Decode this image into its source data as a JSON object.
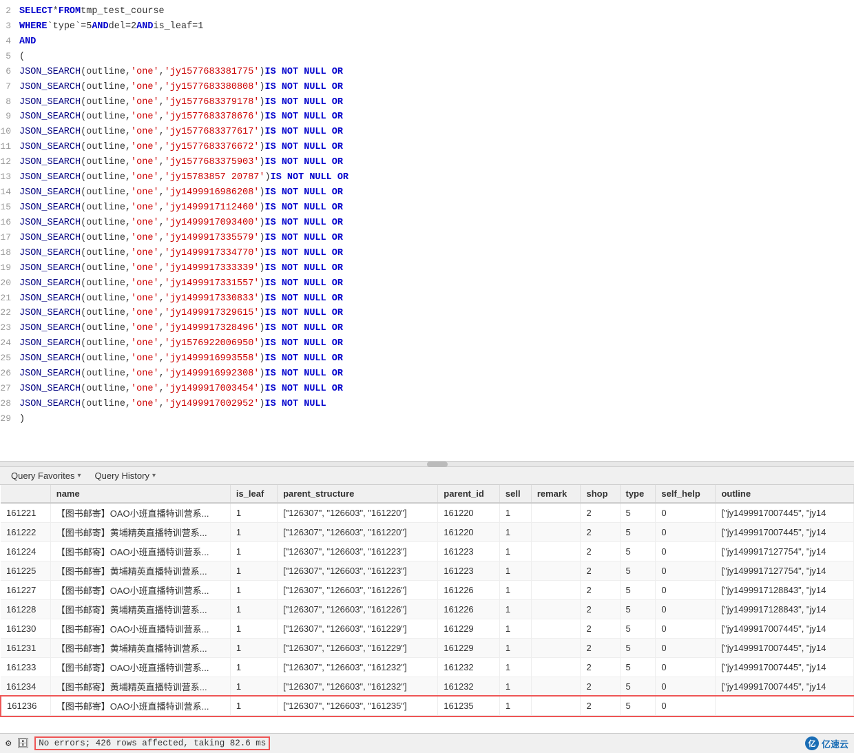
{
  "editor": {
    "lines": [
      {
        "num": 2,
        "tokens": [
          {
            "t": "kw",
            "v": "SELECT"
          },
          {
            "t": "plain",
            "v": " * "
          },
          {
            "t": "kw",
            "v": "FROM"
          },
          {
            "t": "plain",
            "v": " tmp_test_course"
          }
        ]
      },
      {
        "num": 3,
        "tokens": [
          {
            "t": "kw",
            "v": "WHERE"
          },
          {
            "t": "plain",
            "v": " "
          },
          {
            "t": "plain",
            "v": "`type`"
          },
          {
            "t": "plain",
            "v": "=5 "
          },
          {
            "t": "kw",
            "v": "AND"
          },
          {
            "t": "plain",
            "v": " del=2 "
          },
          {
            "t": "kw",
            "v": "AND"
          },
          {
            "t": "plain",
            "v": " is_leaf=1"
          }
        ]
      },
      {
        "num": 4,
        "tokens": [
          {
            "t": "kw",
            "v": "AND"
          }
        ]
      },
      {
        "num": 5,
        "tokens": [
          {
            "t": "plain",
            "v": "("
          }
        ]
      },
      {
        "num": 6,
        "tokens": [
          {
            "t": "fn",
            "v": "JSON_SEARCH"
          },
          {
            "t": "plain",
            "v": "(outline, "
          },
          {
            "t": "str",
            "v": "'one'"
          },
          {
            "t": "plain",
            "v": ", "
          },
          {
            "t": "str",
            "v": "'jy1577683381775'"
          },
          {
            "t": "plain",
            "v": ")"
          },
          {
            "t": "op",
            "v": " IS NOT NULL OR"
          }
        ]
      },
      {
        "num": 7,
        "tokens": [
          {
            "t": "fn",
            "v": "JSON_SEARCH"
          },
          {
            "t": "plain",
            "v": "(outline, "
          },
          {
            "t": "str",
            "v": "'one'"
          },
          {
            "t": "plain",
            "v": ", "
          },
          {
            "t": "str",
            "v": "'jy1577683380808'"
          },
          {
            "t": "plain",
            "v": ")"
          },
          {
            "t": "op",
            "v": " IS NOT NULL OR"
          }
        ]
      },
      {
        "num": 8,
        "tokens": [
          {
            "t": "fn",
            "v": "JSON_SEARCH"
          },
          {
            "t": "plain",
            "v": "(outline, "
          },
          {
            "t": "str",
            "v": "'one'"
          },
          {
            "t": "plain",
            "v": ", "
          },
          {
            "t": "str",
            "v": "'jy1577683379178'"
          },
          {
            "t": "plain",
            "v": ")"
          },
          {
            "t": "op",
            "v": " IS NOT NULL OR"
          }
        ]
      },
      {
        "num": 9,
        "tokens": [
          {
            "t": "fn",
            "v": "JSON_SEARCH"
          },
          {
            "t": "plain",
            "v": "(outline, "
          },
          {
            "t": "str",
            "v": "'one'"
          },
          {
            "t": "plain",
            "v": ", "
          },
          {
            "t": "str",
            "v": "'jy1577683378676'"
          },
          {
            "t": "plain",
            "v": ")"
          },
          {
            "t": "op",
            "v": " IS NOT NULL OR"
          }
        ]
      },
      {
        "num": 10,
        "tokens": [
          {
            "t": "fn",
            "v": "JSON_SEARCH"
          },
          {
            "t": "plain",
            "v": "(outline, "
          },
          {
            "t": "str",
            "v": "'one'"
          },
          {
            "t": "plain",
            "v": ", "
          },
          {
            "t": "str",
            "v": "'jy1577683377617'"
          },
          {
            "t": "plain",
            "v": ")"
          },
          {
            "t": "op",
            "v": " IS NOT NULL OR"
          }
        ]
      },
      {
        "num": 11,
        "tokens": [
          {
            "t": "fn",
            "v": "JSON_SEARCH"
          },
          {
            "t": "plain",
            "v": "(outline, "
          },
          {
            "t": "str",
            "v": "'one'"
          },
          {
            "t": "plain",
            "v": ", "
          },
          {
            "t": "str",
            "v": "'jy1577683376672'"
          },
          {
            "t": "plain",
            "v": ")"
          },
          {
            "t": "op",
            "v": " IS NOT NULL OR"
          }
        ]
      },
      {
        "num": 12,
        "tokens": [
          {
            "t": "fn",
            "v": "JSON_SEARCH"
          },
          {
            "t": "plain",
            "v": "(outline, "
          },
          {
            "t": "str",
            "v": "'one'"
          },
          {
            "t": "plain",
            "v": ", "
          },
          {
            "t": "str",
            "v": "'jy1577683375903'"
          },
          {
            "t": "plain",
            "v": ")"
          },
          {
            "t": "op",
            "v": " IS NOT NULL OR"
          }
        ]
      },
      {
        "num": 13,
        "tokens": [
          {
            "t": "fn",
            "v": "JSON_SEARCH"
          },
          {
            "t": "plain",
            "v": "(outline, "
          },
          {
            "t": "str",
            "v": "'one'"
          },
          {
            "t": "plain",
            "v": ", "
          },
          {
            "t": "str",
            "v": "'jy15783857 20787'"
          },
          {
            "t": "plain",
            "v": ")"
          },
          {
            "t": "op",
            "v": " IS NOT NULL OR"
          }
        ]
      },
      {
        "num": 14,
        "tokens": [
          {
            "t": "fn",
            "v": "JSON_SEARCH"
          },
          {
            "t": "plain",
            "v": "(outline, "
          },
          {
            "t": "str",
            "v": "'one'"
          },
          {
            "t": "plain",
            "v": ", "
          },
          {
            "t": "str",
            "v": "'jy1499916986208'"
          },
          {
            "t": "plain",
            "v": ")"
          },
          {
            "t": "op",
            "v": " IS NOT NULL OR"
          }
        ]
      },
      {
        "num": 15,
        "tokens": [
          {
            "t": "fn",
            "v": "JSON_SEARCH"
          },
          {
            "t": "plain",
            "v": "(outline, "
          },
          {
            "t": "str",
            "v": "'one'"
          },
          {
            "t": "plain",
            "v": ", "
          },
          {
            "t": "str",
            "v": "'jy1499917112460'"
          },
          {
            "t": "plain",
            "v": ")"
          },
          {
            "t": "op",
            "v": " IS NOT NULL OR"
          }
        ]
      },
      {
        "num": 16,
        "tokens": [
          {
            "t": "fn",
            "v": "JSON_SEARCH"
          },
          {
            "t": "plain",
            "v": "(outline, "
          },
          {
            "t": "str",
            "v": "'one'"
          },
          {
            "t": "plain",
            "v": ", "
          },
          {
            "t": "str",
            "v": "'jy1499917093400'"
          },
          {
            "t": "plain",
            "v": ")"
          },
          {
            "t": "op",
            "v": " IS NOT NULL OR"
          }
        ]
      },
      {
        "num": 17,
        "tokens": [
          {
            "t": "fn",
            "v": "JSON_SEARCH"
          },
          {
            "t": "plain",
            "v": "(outline, "
          },
          {
            "t": "str",
            "v": "'one'"
          },
          {
            "t": "plain",
            "v": ", "
          },
          {
            "t": "str",
            "v": "'jy1499917335579'"
          },
          {
            "t": "plain",
            "v": ")"
          },
          {
            "t": "op",
            "v": " IS NOT NULL OR"
          }
        ]
      },
      {
        "num": 18,
        "tokens": [
          {
            "t": "fn",
            "v": "JSON_SEARCH"
          },
          {
            "t": "plain",
            "v": "(outline, "
          },
          {
            "t": "str",
            "v": "'one'"
          },
          {
            "t": "plain",
            "v": ", "
          },
          {
            "t": "str",
            "v": "'jy1499917334770'"
          },
          {
            "t": "plain",
            "v": ")"
          },
          {
            "t": "op",
            "v": " IS NOT NULL OR"
          }
        ]
      },
      {
        "num": 19,
        "tokens": [
          {
            "t": "fn",
            "v": "JSON_SEARCH"
          },
          {
            "t": "plain",
            "v": "(outline, "
          },
          {
            "t": "str",
            "v": "'one'"
          },
          {
            "t": "plain",
            "v": ", "
          },
          {
            "t": "str",
            "v": "'jy1499917333339'"
          },
          {
            "t": "plain",
            "v": ")"
          },
          {
            "t": "op",
            "v": " IS NOT NULL OR"
          }
        ]
      },
      {
        "num": 20,
        "tokens": [
          {
            "t": "fn",
            "v": "JSON_SEARCH"
          },
          {
            "t": "plain",
            "v": "(outline, "
          },
          {
            "t": "str",
            "v": "'one'"
          },
          {
            "t": "plain",
            "v": ", "
          },
          {
            "t": "str",
            "v": "'jy1499917331557'"
          },
          {
            "t": "plain",
            "v": ")"
          },
          {
            "t": "op",
            "v": " IS NOT NULL OR"
          }
        ]
      },
      {
        "num": 21,
        "tokens": [
          {
            "t": "fn",
            "v": "JSON_SEARCH"
          },
          {
            "t": "plain",
            "v": "(outline, "
          },
          {
            "t": "str",
            "v": "'one'"
          },
          {
            "t": "plain",
            "v": ", "
          },
          {
            "t": "str",
            "v": "'jy1499917330833'"
          },
          {
            "t": "plain",
            "v": ")"
          },
          {
            "t": "op",
            "v": " IS NOT NULL OR"
          }
        ]
      },
      {
        "num": 22,
        "tokens": [
          {
            "t": "fn",
            "v": "JSON_SEARCH"
          },
          {
            "t": "plain",
            "v": "(outline, "
          },
          {
            "t": "str",
            "v": "'one'"
          },
          {
            "t": "plain",
            "v": ", "
          },
          {
            "t": "str",
            "v": "'jy1499917329615'"
          },
          {
            "t": "plain",
            "v": ")"
          },
          {
            "t": "op",
            "v": " IS NOT NULL OR"
          }
        ]
      },
      {
        "num": 23,
        "tokens": [
          {
            "t": "fn",
            "v": "JSON_SEARCH"
          },
          {
            "t": "plain",
            "v": "(outline, "
          },
          {
            "t": "str",
            "v": "'one'"
          },
          {
            "t": "plain",
            "v": ", "
          },
          {
            "t": "str",
            "v": "'jy1499917328496'"
          },
          {
            "t": "plain",
            "v": ")"
          },
          {
            "t": "op",
            "v": " IS NOT NULL OR"
          }
        ]
      },
      {
        "num": 24,
        "tokens": [
          {
            "t": "fn",
            "v": "JSON_SEARCH"
          },
          {
            "t": "plain",
            "v": "(outline, "
          },
          {
            "t": "str",
            "v": "'one'"
          },
          {
            "t": "plain",
            "v": ", "
          },
          {
            "t": "str",
            "v": "'jy1576922006950'"
          },
          {
            "t": "plain",
            "v": ")"
          },
          {
            "t": "op",
            "v": " IS NOT NULL OR"
          }
        ]
      },
      {
        "num": 25,
        "tokens": [
          {
            "t": "fn",
            "v": "JSON_SEARCH"
          },
          {
            "t": "plain",
            "v": "(outline, "
          },
          {
            "t": "str",
            "v": "'one'"
          },
          {
            "t": "plain",
            "v": ", "
          },
          {
            "t": "str",
            "v": "'jy1499916993558'"
          },
          {
            "t": "plain",
            "v": ")"
          },
          {
            "t": "op",
            "v": " IS NOT NULL OR"
          }
        ]
      },
      {
        "num": 26,
        "tokens": [
          {
            "t": "fn",
            "v": "JSON_SEARCH"
          },
          {
            "t": "plain",
            "v": "(outline, "
          },
          {
            "t": "str",
            "v": "'one'"
          },
          {
            "t": "plain",
            "v": ", "
          },
          {
            "t": "str",
            "v": "'jy1499916992308'"
          },
          {
            "t": "plain",
            "v": ")"
          },
          {
            "t": "op",
            "v": " IS NOT NULL OR"
          }
        ]
      },
      {
        "num": 27,
        "tokens": [
          {
            "t": "fn",
            "v": "JSON_SEARCH"
          },
          {
            "t": "plain",
            "v": "(outline, "
          },
          {
            "t": "str",
            "v": "'one'"
          },
          {
            "t": "plain",
            "v": ", "
          },
          {
            "t": "str",
            "v": "'jy1499917003454'"
          },
          {
            "t": "plain",
            "v": ")"
          },
          {
            "t": "op",
            "v": " IS NOT NULL OR"
          }
        ]
      },
      {
        "num": 28,
        "tokens": [
          {
            "t": "fn",
            "v": "JSON_SEARCH"
          },
          {
            "t": "plain",
            "v": "(outline, "
          },
          {
            "t": "str",
            "v": "'one'"
          },
          {
            "t": "plain",
            "v": ", "
          },
          {
            "t": "str",
            "v": "'jy1499917002952'"
          },
          {
            "t": "plain",
            "v": ")"
          },
          {
            "t": "op",
            "v": " IS NOT NULL"
          }
        ]
      },
      {
        "num": 29,
        "tokens": [
          {
            "t": "plain",
            "v": ")"
          }
        ]
      }
    ]
  },
  "toolbar": {
    "query_favorites_label": "Query Favorites",
    "query_favorites_chevron": "▾",
    "query_history_label": "Query History",
    "query_history_chevron": "▾"
  },
  "table": {
    "columns": [
      "",
      "name",
      "is_leaf",
      "parent_structure",
      "parent_id",
      "sell",
      "remark",
      "shop",
      "type",
      "self_help",
      "outline"
    ],
    "rows": [
      [
        "161221",
        "【图书邮寄】OAO小班直播特训营系...",
        "1",
        "[\"126307\", \"126603\", \"161220\"]",
        "161220",
        "1",
        "",
        "2",
        "5",
        "0",
        "[\"jy1499917007445\", \"jy14"
      ],
      [
        "161222",
        "【图书邮寄】黄埔精英直播特训营系...",
        "1",
        "[\"126307\", \"126603\", \"161220\"]",
        "161220",
        "1",
        "",
        "2",
        "5",
        "0",
        "[\"jy1499917007445\", \"jy14"
      ],
      [
        "161224",
        "【图书邮寄】OAO小班直播特训营系...",
        "1",
        "[\"126307\", \"126603\", \"161223\"]",
        "161223",
        "1",
        "",
        "2",
        "5",
        "0",
        "[\"jy1499917127754\", \"jy14"
      ],
      [
        "161225",
        "【图书邮寄】黄埔精英直播特训营系...",
        "1",
        "[\"126307\", \"126603\", \"161223\"]",
        "161223",
        "1",
        "",
        "2",
        "5",
        "0",
        "[\"jy1499917127754\", \"jy14"
      ],
      [
        "161227",
        "【图书邮寄】OAO小班直播特训营系...",
        "1",
        "[\"126307\", \"126603\", \"161226\"]",
        "161226",
        "1",
        "",
        "2",
        "5",
        "0",
        "[\"jy1499917128843\", \"jy14"
      ],
      [
        "161228",
        "【图书邮寄】黄埔精英直播特训营系...",
        "1",
        "[\"126307\", \"126603\", \"161226\"]",
        "161226",
        "1",
        "",
        "2",
        "5",
        "0",
        "[\"jy1499917128843\", \"jy14"
      ],
      [
        "161230",
        "【图书邮寄】OAO小班直播特训营系...",
        "1",
        "[\"126307\", \"126603\", \"161229\"]",
        "161229",
        "1",
        "",
        "2",
        "5",
        "0",
        "[\"jy1499917007445\", \"jy14"
      ],
      [
        "161231",
        "【图书邮寄】黄埔精英直播特训营系...",
        "1",
        "[\"126307\", \"126603\", \"161229\"]",
        "161229",
        "1",
        "",
        "2",
        "5",
        "0",
        "[\"jy1499917007445\", \"jy14"
      ],
      [
        "161233",
        "【图书邮寄】OAO小班直播特训营系...",
        "1",
        "[\"126307\", \"126603\", \"161232\"]",
        "161232",
        "1",
        "",
        "2",
        "5",
        "0",
        "[\"jy1499917007445\", \"jy14"
      ],
      [
        "161234",
        "【图书邮寄】黄埔精英直播特训营系...",
        "1",
        "[\"126307\", \"126603\", \"161232\"]",
        "161232",
        "1",
        "",
        "2",
        "5",
        "0",
        "[\"jy1499917007445\", \"jy14"
      ],
      [
        "161236",
        "【图书邮寄】OAO小班直播特训营系...",
        "1",
        "[\"126307\", \"126603\", \"161235\"]",
        "161235",
        "1",
        "",
        "2",
        "5",
        "0",
        ""
      ]
    ]
  },
  "status": {
    "icon": "⚙",
    "db_icon": "🗄",
    "message": "No errors; 426 rows affected, taking 82.6 ms",
    "logo": "亿速云"
  }
}
